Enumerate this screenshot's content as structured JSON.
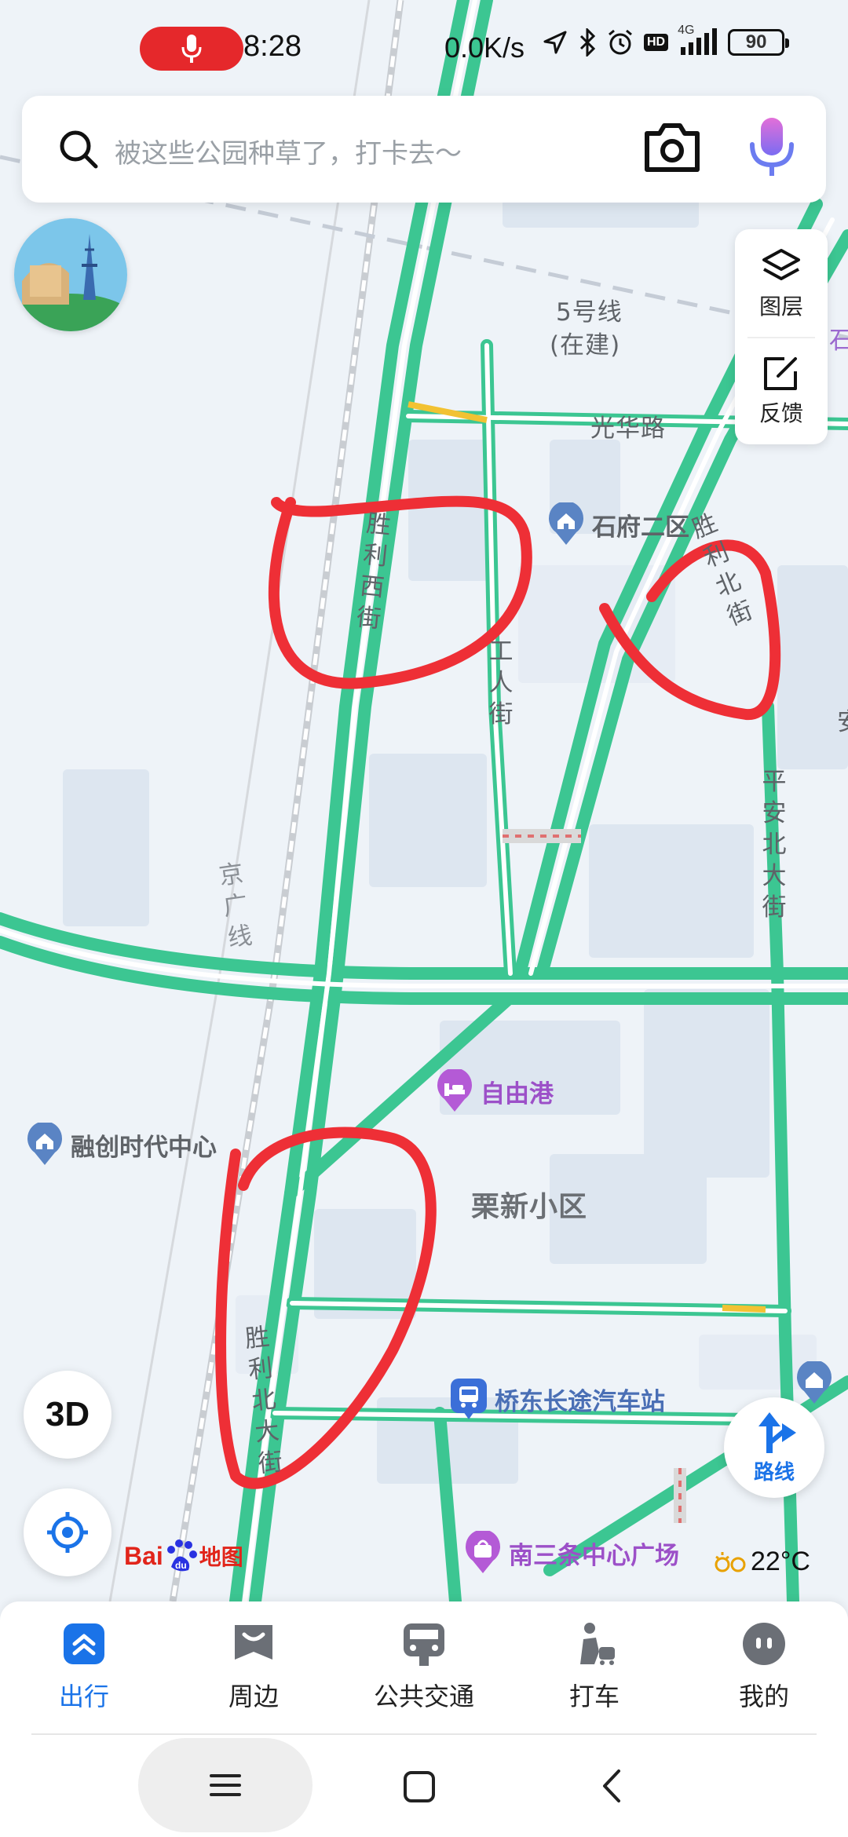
{
  "status_bar": {
    "time": "8:28",
    "net_speed": "0.0K/s",
    "signal_type": "4G",
    "hd": "HD",
    "battery": "90"
  },
  "search": {
    "placeholder": "被这些公园种草了，打卡去～"
  },
  "map_tools": {
    "layers": "图层",
    "feedback": "反馈"
  },
  "map": {
    "metro": "5号线",
    "metro_status": "(在建)",
    "road_guanghua": "光华路",
    "road_shengli_west": "胜利西街",
    "road_gongren": "工人街",
    "road_shengli_north_upper": "胜利北街",
    "road_pingan": "平安北大街",
    "rail_jingguang": "京广线",
    "road_shengli_north_lower": "胜利北大街",
    "area_lixin": "栗新小区",
    "edge_label_right": "石",
    "edge_label_right2": "安",
    "pois": [
      {
        "name": "石府二区"
      },
      {
        "name": "自由港"
      },
      {
        "name": "融创时代中心"
      },
      {
        "name": "桥东长途汽车站"
      },
      {
        "name": "南三条中心广场"
      }
    ]
  },
  "controls": {
    "btn_3d": "3D",
    "route": "路线"
  },
  "logo": {
    "bai": "Bai",
    "du": "du",
    "cn": "地图"
  },
  "weather": {
    "temp": "22°C"
  },
  "bottom_nav": [
    {
      "label": "出行",
      "active": true
    },
    {
      "label": "周边",
      "active": false
    },
    {
      "label": "公共交通",
      "active": false
    },
    {
      "label": "打车",
      "active": false
    },
    {
      "label": "我的",
      "active": false
    }
  ],
  "colors": {
    "accent": "#1a73e8",
    "road_green": "#3cc692",
    "annotation_red": "#ee2f36"
  }
}
